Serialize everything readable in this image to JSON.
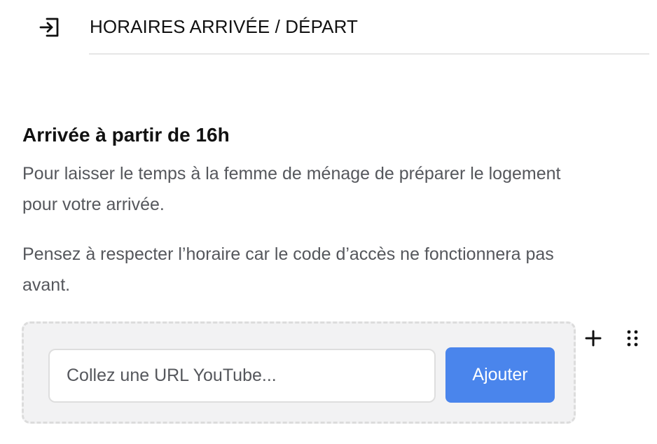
{
  "header": {
    "icon": "sign-in-icon",
    "title": "HORAIRES ARRIVÉE / DÉPART"
  },
  "content": {
    "heading": "Arrivée à partir de 16h",
    "paragraphs": [
      "Pour laisser le temps à la femme de ménage de préparer le logement pour votre arrivée.",
      "Pensez à respecter l’horaire car le code d’accès ne fonctionnera pas avant."
    ]
  },
  "embed": {
    "input_value": "",
    "input_placeholder": "Collez une URL YouTube...",
    "button_label": "Ajouter"
  },
  "tools": {
    "add_icon": "plus-icon",
    "drag_icon": "drag-handle-icon"
  },
  "colors": {
    "text_primary": "#111111",
    "text_secondary": "#55575c",
    "accent": "#4a85ec",
    "embed_background": "#f2f2f3",
    "embed_border": "#dcdcdc",
    "divider": "#e6e6e6"
  }
}
